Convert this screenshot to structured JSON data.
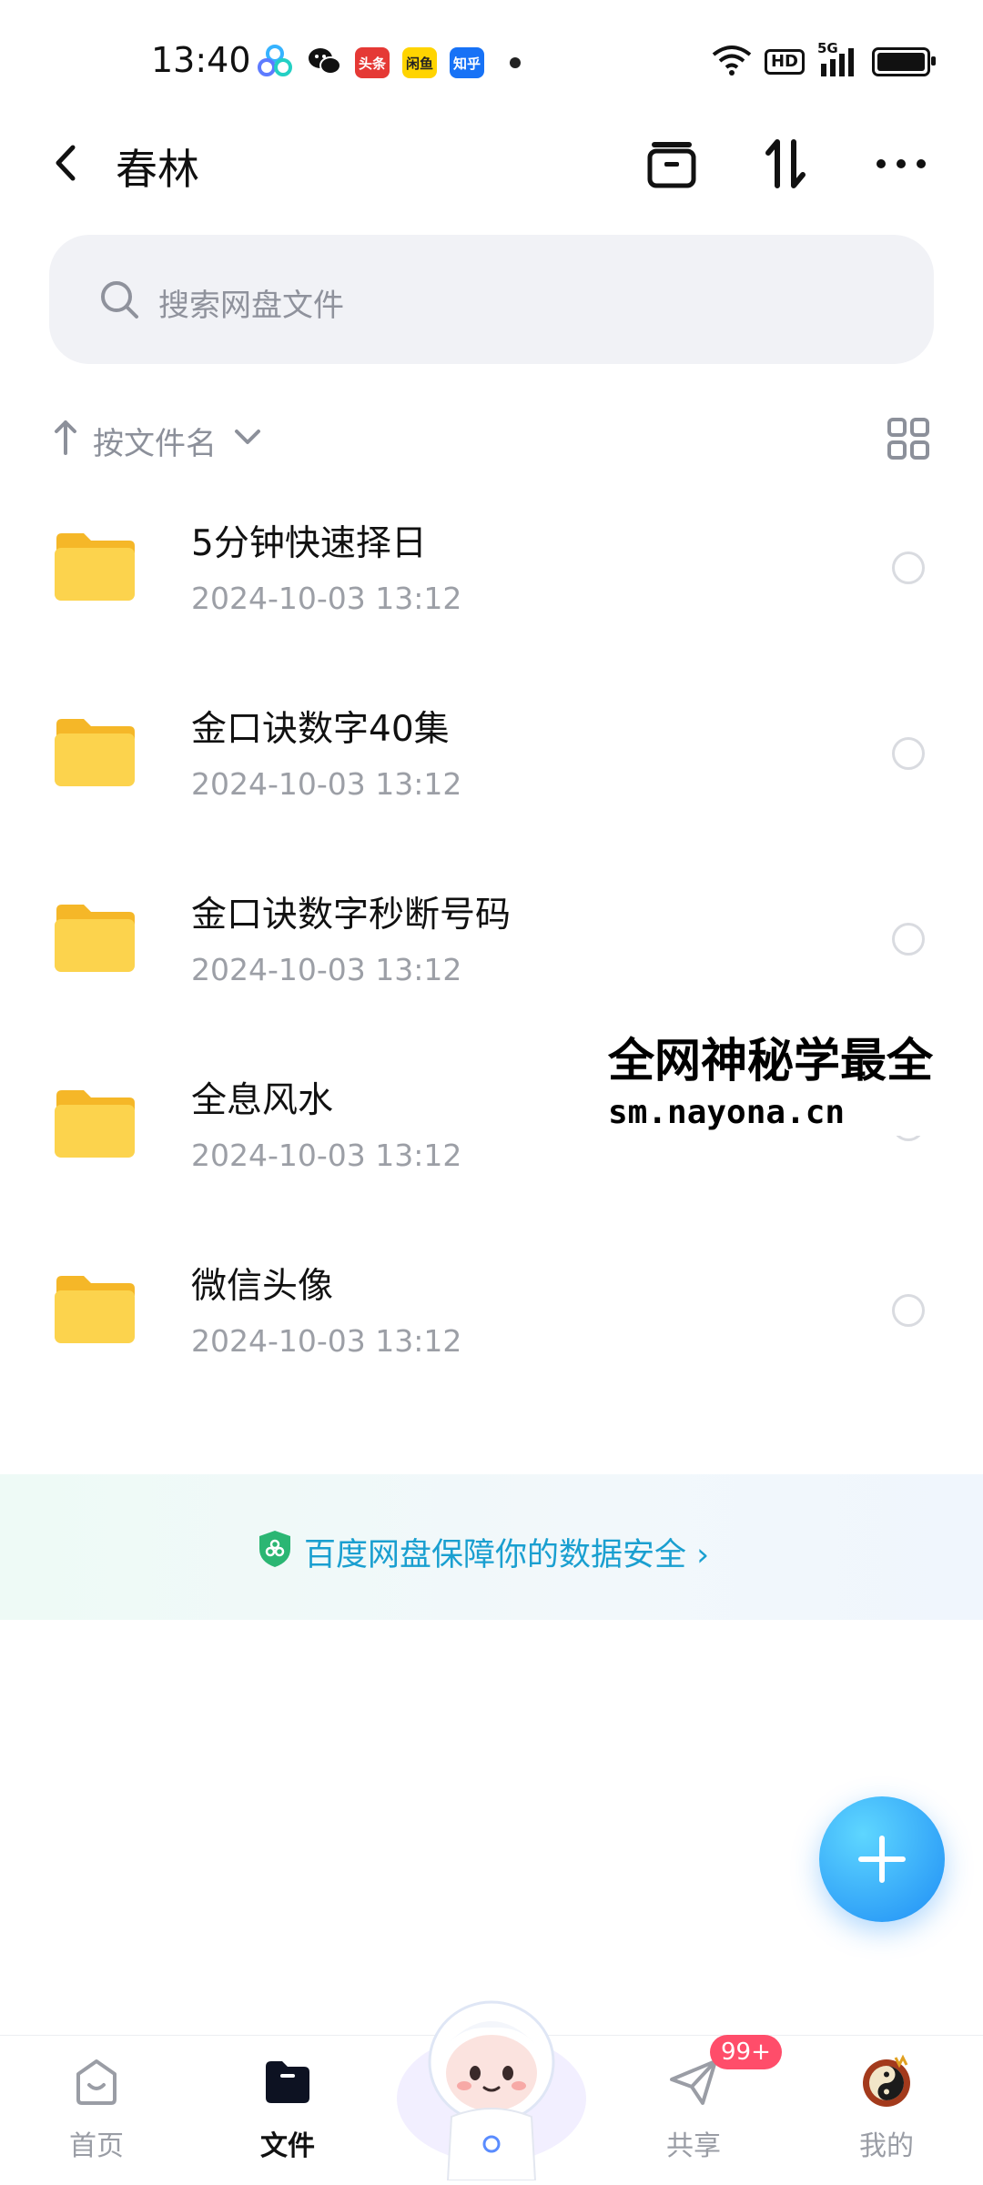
{
  "status_bar": {
    "time": "13:40",
    "apps": [
      {
        "name": "baidu-netdisk-icon",
        "label": ""
      },
      {
        "name": "wechat-icon",
        "label": ""
      },
      {
        "name": "toutiao-icon",
        "label": "头条"
      },
      {
        "name": "xianyu-icon",
        "label": "闲鱼"
      },
      {
        "name": "zhihu-icon",
        "label": "知乎"
      }
    ],
    "network": "5G",
    "hd": "HD"
  },
  "header": {
    "title": "春林"
  },
  "search": {
    "placeholder": "搜索网盘文件"
  },
  "sort": {
    "label": "按文件名"
  },
  "files": [
    {
      "name": "5分钟快速择日",
      "date": "2024-10-03  13:12"
    },
    {
      "name": "金口诀数字40集",
      "date": "2024-10-03  13:12"
    },
    {
      "name": "金口诀数字秒断号码",
      "date": "2024-10-03  13:12"
    },
    {
      "name": "全息风水",
      "date": "2024-10-03  13:12"
    },
    {
      "name": "微信头像",
      "date": "2024-10-03  13:12"
    }
  ],
  "watermark": {
    "line1": "全网神秘学最全",
    "line2": "sm.nayona.cn"
  },
  "safety_banner": {
    "text": "百度网盘保障你的数据安全 ›"
  },
  "bottom_nav": {
    "items": [
      {
        "label": "首页",
        "active": false
      },
      {
        "label": "文件",
        "active": true
      },
      {
        "label": "共享",
        "active": false
      },
      {
        "label": "我的",
        "active": false
      }
    ],
    "share_badge": "99+"
  },
  "colors": {
    "accent": "#1f8ef5",
    "folder": "#fcd34d",
    "badge": "#ff4d6a",
    "banner_text": "#1a9fd0"
  }
}
